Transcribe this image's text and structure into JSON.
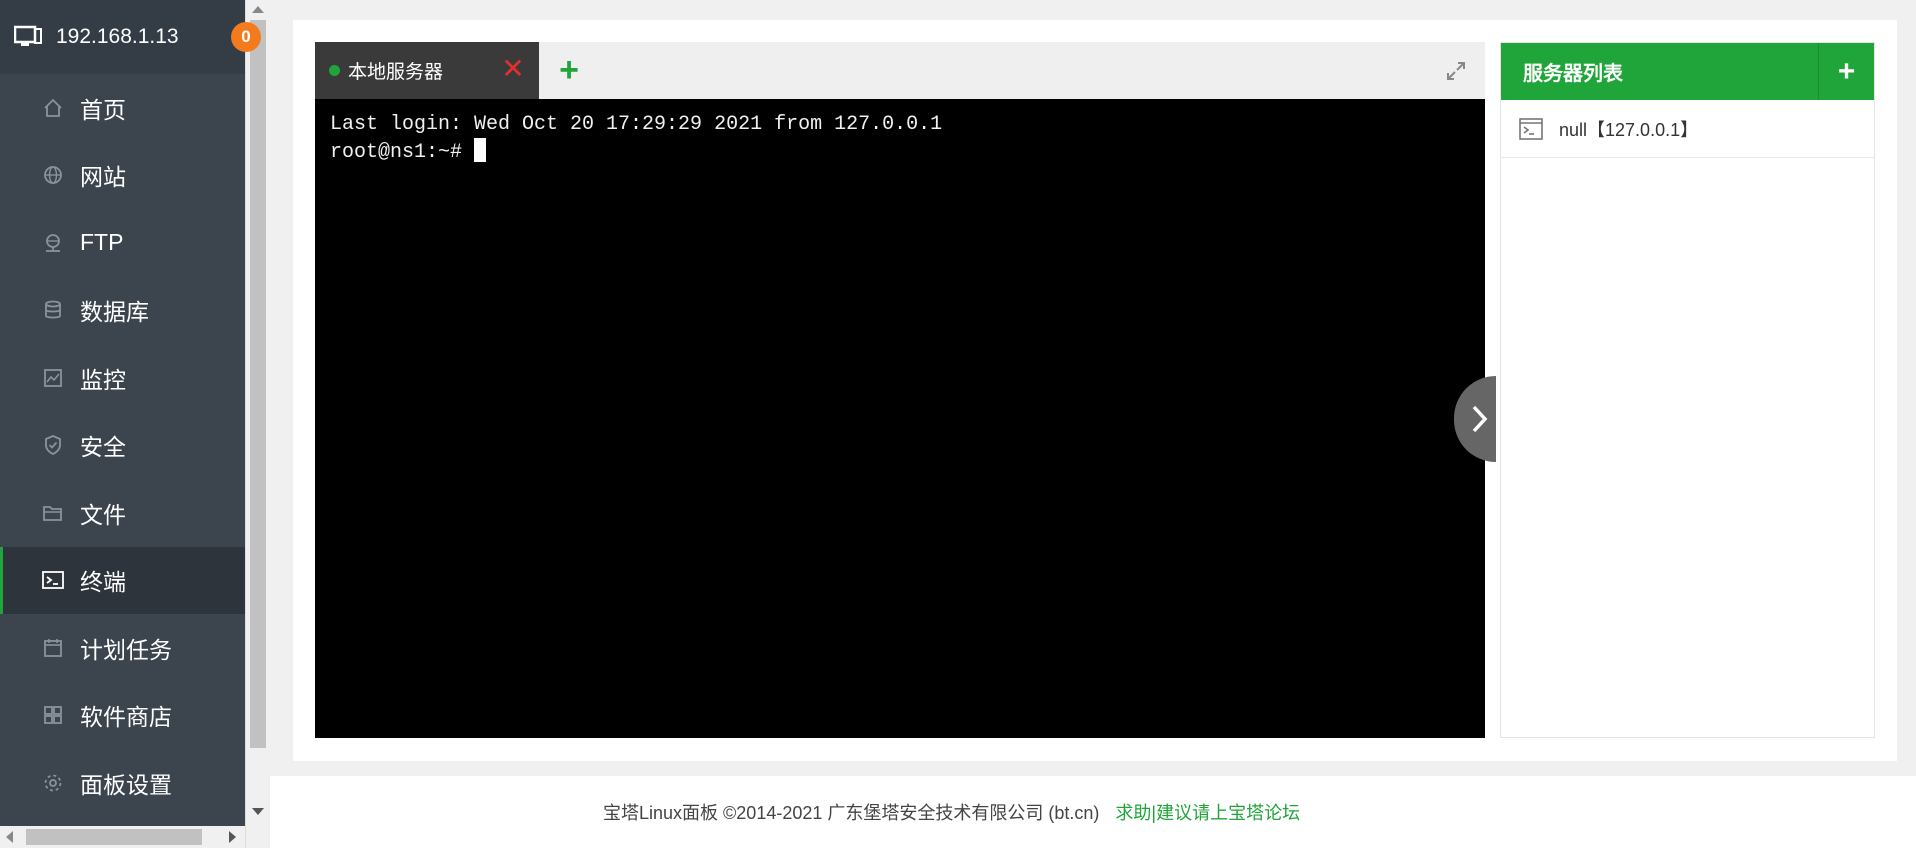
{
  "sidebar": {
    "host": "192.168.1.13",
    "badge": "0",
    "items": [
      {
        "label": "首页",
        "icon": "home-icon"
      },
      {
        "label": "网站",
        "icon": "globe-icon"
      },
      {
        "label": "FTP",
        "icon": "ftp-icon"
      },
      {
        "label": "数据库",
        "icon": "database-icon"
      },
      {
        "label": "监控",
        "icon": "monitor-icon"
      },
      {
        "label": "安全",
        "icon": "shield-icon"
      },
      {
        "label": "文件",
        "icon": "folder-icon"
      },
      {
        "label": "终端",
        "icon": "terminal-icon",
        "active": true
      },
      {
        "label": "计划任务",
        "icon": "calendar-icon"
      },
      {
        "label": "软件商店",
        "icon": "apps-icon"
      },
      {
        "label": "面板设置",
        "icon": "gear-icon"
      }
    ]
  },
  "terminal": {
    "tab_label": "本地服务器",
    "close_symbol": "✕",
    "add_symbol": "+",
    "lines": [
      "Last login: Wed Oct 20 17:29:29 2021 from 127.0.0.1",
      "root@ns1:~# "
    ]
  },
  "server_list": {
    "title": "服务器列表",
    "add_symbol": "+",
    "items": [
      {
        "label": "null【127.0.0.1】"
      }
    ]
  },
  "footer": {
    "copyright": "宝塔Linux面板 ©2014-2021 广东堡塔安全技术有限公司 (bt.cn)",
    "link": "求助|建议请上宝塔论坛"
  },
  "colors": {
    "brand_green": "#20a53a",
    "sidebar_bg": "#3c444d",
    "badge_orange": "#f37b1d",
    "close_red": "#e0302f"
  }
}
